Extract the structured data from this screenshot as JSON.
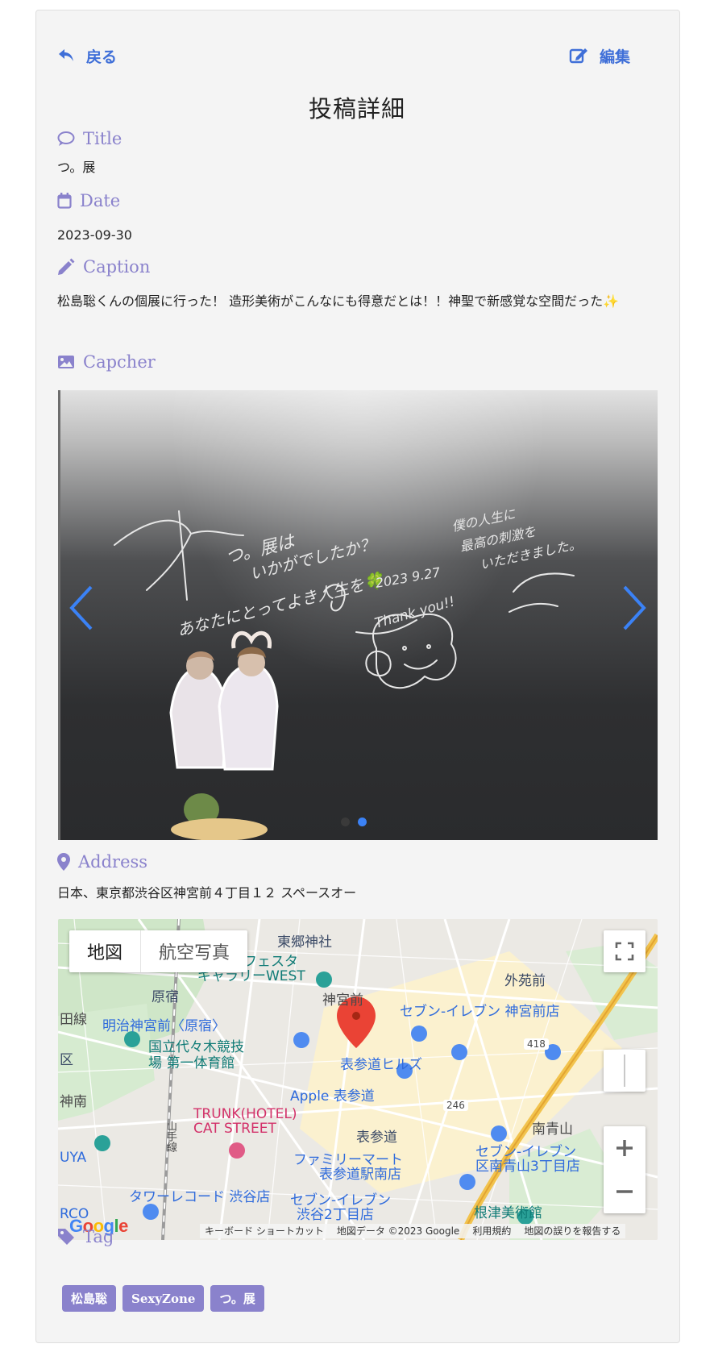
{
  "nav": {
    "back_label": "戻る",
    "edit_label": "編集"
  },
  "page_title": "投稿詳細",
  "fields": {
    "title": {
      "heading": "Title",
      "value": "つ。展"
    },
    "date": {
      "heading": "Date",
      "value": "2023-09-30"
    },
    "caption": {
      "heading": "Caption",
      "value": "松島聡くんの個展に行った！ 造形美術がこんなにも得意だとは！！神聖で新感覚な空間だった✨"
    },
    "capcher": {
      "heading": "Capcher"
    },
    "address": {
      "heading": "Address",
      "value": "日本、東京都渋谷区神宮前４丁目１２ スペースオー"
    },
    "tag": {
      "heading": "Tag"
    }
  },
  "carousel": {
    "image_alt": "松島聡 個展のメッセージボードとアクリルスタンド",
    "slide_count": 2,
    "active_slide": 2,
    "handwriting": {
      "line1": "つ。展は",
      "line2": "いかがでしたか？",
      "line3": "あなたにとってよき人生を🍀",
      "date": "2023 9.27",
      "thanks": "Thank you!!",
      "right1": "僕の人生に",
      "right2": "最高の刺激を",
      "right3": "いただきました。"
    }
  },
  "map": {
    "type_map": "地図",
    "type_satellite": "航空写真",
    "labels": [
      "東郷神社",
      "フェスタ",
      "ギャラリーWEST",
      "原宿",
      "外苑前",
      "神宮前",
      "明治神宮前〈原宿〉",
      "セブン-イレブン 神宮前店",
      "国立代々木競技",
      "場 第一体育館",
      "表参道ヒルズ",
      "Apple 表参道",
      "418",
      "246",
      "南青山",
      "TRUNK(HOTEL)",
      "CAT STREET",
      "表参道",
      "ファミリーマート",
      "表参道駅南店",
      "セブン-イレブン",
      "区南青山3丁目店",
      "タワーレコード 渋谷店",
      "セブン-イレブン",
      "渋谷2丁目店",
      "根津美術館",
      "山手線",
      "神南",
      "UYA",
      "田線",
      "区",
      "RCO"
    ],
    "google_logo": "Google",
    "attribution": [
      "キーボード ショートカット",
      "地図データ ©2023 Google",
      "利用規約",
      "地図の誤りを報告する"
    ]
  },
  "tags": [
    "松島聡",
    "SexyZone",
    "つ。展"
  ],
  "colors": {
    "accent": "#8a82cc",
    "link": "#3f6fd8",
    "card": "#f4f4f4",
    "active_dot": "#3b82f6",
    "pin": "#ea4335"
  }
}
